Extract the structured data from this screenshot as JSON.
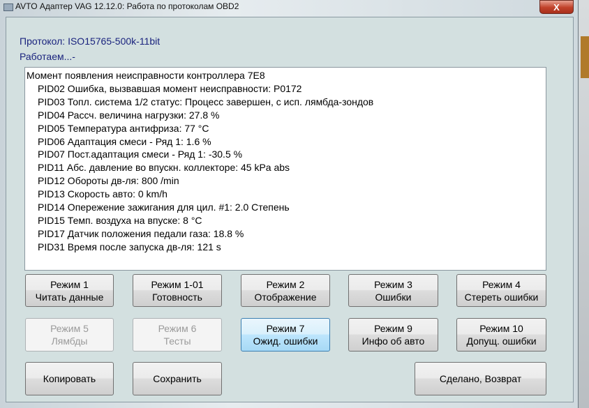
{
  "window": {
    "title": "AVTO Адаптер VAG 12.12.0:  Работа по протоколам OBD2",
    "close": "X"
  },
  "protocol": "Протокол: ISO15765-500k-11bit",
  "status": "Работаем...-",
  "log": {
    "header": "Момент появления неисправности контроллера 7E8",
    "lines": [
      "PID02 Ошибка, вызвавшая момент неисправности: P0172",
      "PID03 Топл. система 1/2 статус: Процесс завершен, с исп. лямбда-зондов",
      "PID04 Рассч. величина нагрузки: 27.8 %",
      "PID05 Температура антифриза: 77 °C",
      "PID06 Адаптация смеси - Ряд 1: 1.6 %",
      "PID07 Пост.адаптация смеси - Ряд 1: -30.5 %",
      "PID11 Абс. давление во впускн. коллекторе: 45 kPa abs",
      "PID12 Обороты дв-ля: 800 /min",
      "PID13 Скорость авто: 0 km/h",
      "PID14 Опережение зажигания для цил. #1: 2.0 Степень",
      "PID15 Темп. воздуха на впуске: 8 °C",
      "PID17 Датчик положения педали газа: 18.8 %",
      "PID31 Время после запуска дв-ля: 121 s"
    ]
  },
  "buttons": [
    {
      "l1": "Режим 1",
      "l2": "Читать данные"
    },
    {
      "l1": "Режим 1-01",
      "l2": "Готовность"
    },
    {
      "l1": "Режим 2",
      "l2": "Отображение"
    },
    {
      "l1": "Режим 3",
      "l2": "Ошибки"
    },
    {
      "l1": "Режим 4",
      "l2": "Стереть ошибки"
    },
    {
      "l1": "Режим 5",
      "l2": "Лямбды"
    },
    {
      "l1": "Режим 6",
      "l2": "Тесты"
    },
    {
      "l1": "Режим 7",
      "l2": "Ожид. ошибки"
    },
    {
      "l1": "Режим 9",
      "l2": "Инфо об авто"
    },
    {
      "l1": "Режим 10",
      "l2": "Допущ. ошибки"
    }
  ],
  "actions": {
    "copy": "Копировать",
    "save": "Сохранить",
    "done": "Сделано, Возврат"
  }
}
